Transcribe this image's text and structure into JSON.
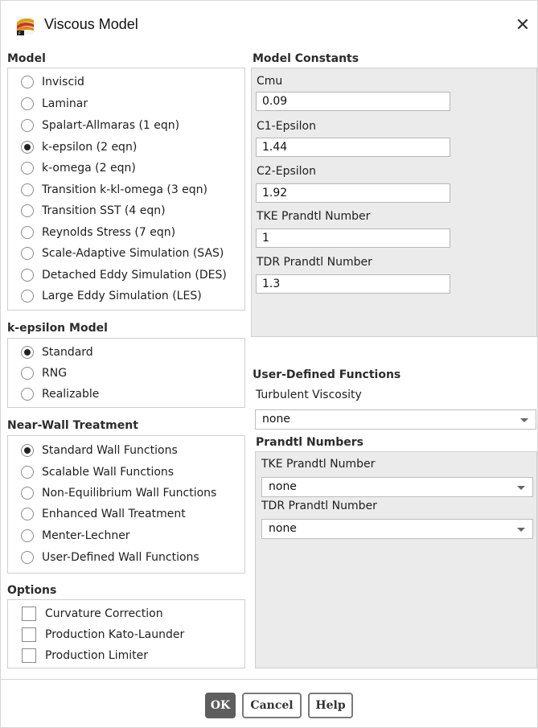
{
  "window": {
    "title": "Viscous Model"
  },
  "model": {
    "label": "Model",
    "options": [
      {
        "label": "Inviscid",
        "selected": false
      },
      {
        "label": "Laminar",
        "selected": false
      },
      {
        "label": "Spalart-Allmaras (1 eqn)",
        "selected": false
      },
      {
        "label": "k-epsilon (2 eqn)",
        "selected": true
      },
      {
        "label": "k-omega (2 eqn)",
        "selected": false
      },
      {
        "label": "Transition k-kl-omega (3 eqn)",
        "selected": false
      },
      {
        "label": "Transition SST (4 eqn)",
        "selected": false
      },
      {
        "label": "Reynolds Stress (7 eqn)",
        "selected": false
      },
      {
        "label": "Scale-Adaptive Simulation (SAS)",
        "selected": false
      },
      {
        "label": "Detached Eddy Simulation (DES)",
        "selected": false
      },
      {
        "label": "Large Eddy Simulation (LES)",
        "selected": false
      }
    ]
  },
  "kepsilon": {
    "label": "k-epsilon Model",
    "options": [
      {
        "label": "Standard",
        "selected": true
      },
      {
        "label": "RNG",
        "selected": false
      },
      {
        "label": "Realizable",
        "selected": false
      }
    ]
  },
  "nearwall": {
    "label": "Near-Wall Treatment",
    "options": [
      {
        "label": "Standard Wall Functions",
        "selected": true
      },
      {
        "label": "Scalable Wall Functions",
        "selected": false
      },
      {
        "label": "Non-Equilibrium Wall Functions",
        "selected": false
      },
      {
        "label": "Enhanced Wall Treatment",
        "selected": false
      },
      {
        "label": "Menter-Lechner",
        "selected": false
      },
      {
        "label": "User-Defined Wall Functions",
        "selected": false
      }
    ]
  },
  "options": {
    "label": "Options",
    "items": [
      {
        "label": "Curvature Correction",
        "checked": false
      },
      {
        "label": "Production Kato-Launder",
        "checked": false
      },
      {
        "label": "Production Limiter",
        "checked": false
      }
    ]
  },
  "constants": {
    "label": "Model Constants",
    "fields": [
      {
        "label": "Cmu",
        "value": "0.09"
      },
      {
        "label": "C1-Epsilon",
        "value": "1.44"
      },
      {
        "label": "C2-Epsilon",
        "value": "1.92"
      },
      {
        "label": "TKE Prandtl Number",
        "value": "1"
      },
      {
        "label": "TDR Prandtl Number",
        "value": "1.3"
      }
    ]
  },
  "udf": {
    "label": "User-Defined Functions",
    "turbulent_viscosity_label": "Turbulent Viscosity",
    "turbulent_viscosity_value": "none",
    "prandtl_label": "Prandtl Numbers",
    "tke_label": "TKE Prandtl Number",
    "tke_value": "none",
    "tdr_label": "TDR Prandtl Number",
    "tdr_value": "none"
  },
  "buttons": {
    "ok": "OK",
    "cancel": "Cancel",
    "help": "Help"
  },
  "icons": {
    "app": "fluent-app-icon",
    "close": "close-icon",
    "dropdown": "chevron-down-icon"
  }
}
